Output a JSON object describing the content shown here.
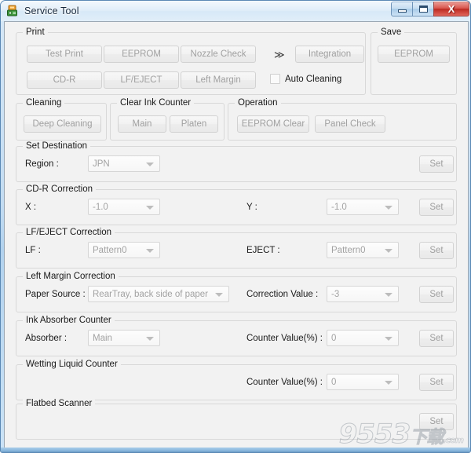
{
  "window": {
    "title": "Service Tool",
    "icon": "printer-app-icon",
    "controls": {
      "minimize": "minimize-icon",
      "maximize": "maximize-icon",
      "close": "X"
    }
  },
  "groups": {
    "print": {
      "legend": "Print",
      "buttons": [
        {
          "label": "Test Print",
          "name": "test-print-button"
        },
        {
          "label": "EEPROM",
          "name": "eeprom-print-button"
        },
        {
          "label": "Nozzle Check",
          "name": "nozzle-check-button"
        },
        {
          "label": "CD-R",
          "name": "cdr-button"
        },
        {
          "label": "LF/EJECT",
          "name": "lf-eject-button"
        },
        {
          "label": "Left Margin",
          "name": "left-margin-button"
        }
      ],
      "chevron": "≫",
      "integration_label": "Integration",
      "auto_cleaning_label": "Auto Cleaning",
      "auto_cleaning_checked": false
    },
    "save": {
      "legend": "Save",
      "eeprom_label": "EEPROM"
    },
    "cleaning": {
      "legend": "Cleaning",
      "deep_cleaning_label": "Deep Cleaning"
    },
    "clear_ink_counter": {
      "legend": "Clear Ink Counter",
      "main_label": "Main",
      "platen_label": "Platen"
    },
    "operation": {
      "legend": "Operation",
      "eeprom_clear_label": "EEPROM Clear",
      "panel_check_label": "Panel Check"
    },
    "set_destination": {
      "legend": "Set Destination",
      "region_label": "Region :",
      "region_value": "JPN",
      "set_label": "Set"
    },
    "cdr_correction": {
      "legend": "CD-R Correction",
      "x_label": "X :",
      "x_value": "-1.0",
      "y_label": "Y :",
      "y_value": "-1.0",
      "set_label": "Set"
    },
    "lf_eject_correction": {
      "legend": "LF/EJECT Correction",
      "lf_label": "LF :",
      "lf_value": "Pattern0",
      "eject_label": "EJECT :",
      "eject_value": "Pattern0",
      "set_label": "Set"
    },
    "left_margin_correction": {
      "legend": "Left Margin Correction",
      "paper_source_label": "Paper Source :",
      "paper_source_value": "RearTray, back side of paper",
      "correction_value_label": "Correction Value :",
      "correction_value": "-3",
      "set_label": "Set"
    },
    "ink_absorber_counter": {
      "legend": "Ink Absorber Counter",
      "absorber_label": "Absorber :",
      "absorber_value": "Main",
      "counter_label": "Counter Value(%) :",
      "counter_value": "0",
      "set_label": "Set"
    },
    "wetting_liquid_counter": {
      "legend": "Wetting Liquid Counter",
      "counter_label": "Counter Value(%) :",
      "counter_value": "0",
      "set_label": "Set"
    },
    "flatbed_scanner": {
      "legend": "Flatbed Scanner",
      "set_label": "Set"
    }
  },
  "watermark": {
    "main": "9553",
    "sub": "下载",
    "dot": ".com"
  }
}
